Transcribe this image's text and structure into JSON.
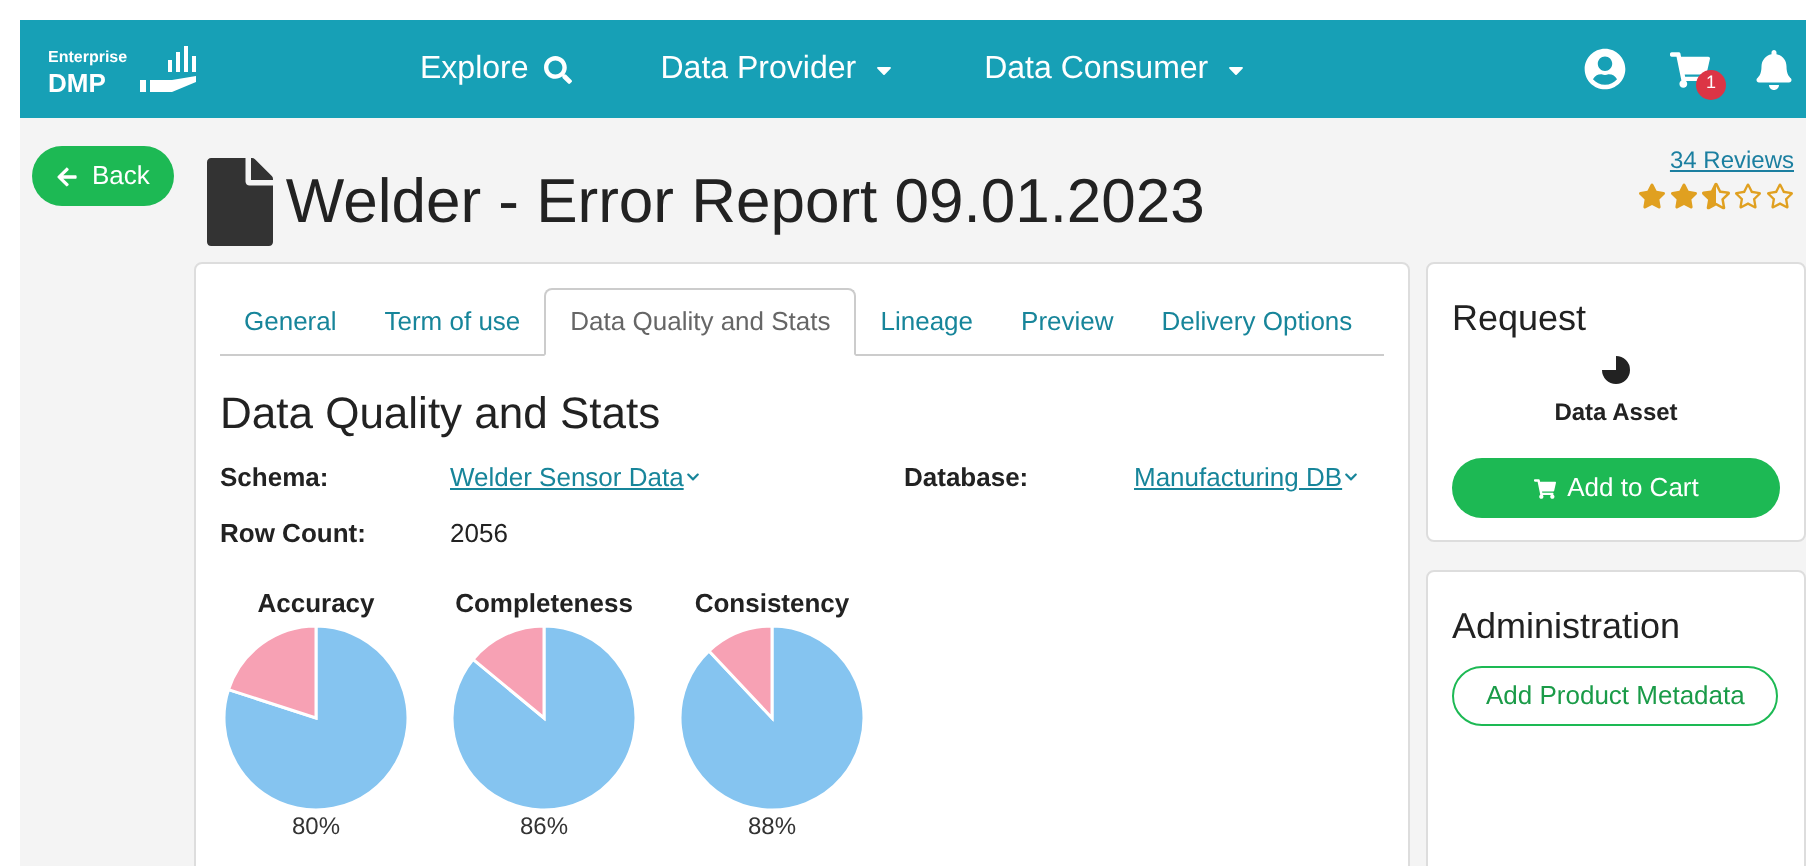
{
  "navbar": {
    "logo": {
      "line1": "Enterprise",
      "line2": "DMP"
    },
    "links": [
      {
        "label": "Explore",
        "kind": "search"
      },
      {
        "label": "Data Provider",
        "kind": "dropdown"
      },
      {
        "label": "Data Consumer",
        "kind": "dropdown"
      }
    ],
    "cart_count": "1"
  },
  "back_button": "Back",
  "title": "Welder - Error Report 09.01.2023",
  "reviews": {
    "link": "34 Reviews",
    "stars": 2.5
  },
  "tabs": [
    {
      "label": "General",
      "selected": false
    },
    {
      "label": "Term of use",
      "selected": false
    },
    {
      "label": "Data Quality and Stats",
      "selected": true
    },
    {
      "label": "Lineage",
      "selected": false
    },
    {
      "label": "Preview",
      "selected": false
    },
    {
      "label": "Delivery Options",
      "selected": false
    }
  ],
  "section": {
    "heading": "Data Quality and Stats",
    "fields": [
      {
        "label": "Schema:",
        "value": "Welder Sensor Data",
        "kind": "link"
      },
      {
        "label": "Database:",
        "value": "Manufacturing DB",
        "kind": "link"
      },
      {
        "label": "Row Count:",
        "value": "2056",
        "kind": "text"
      }
    ]
  },
  "charts": [
    {
      "reading": "80%",
      "chart_data": {
        "type": "pie",
        "title": "Accuracy",
        "values": [
          80,
          20
        ]
      }
    },
    {
      "reading": "86%",
      "chart_data": {
        "type": "pie",
        "title": "Completeness",
        "values": [
          86,
          14
        ]
      }
    },
    {
      "reading": "88%",
      "chart_data": {
        "type": "pie",
        "title": "Consistency",
        "values": [
          88,
          12
        ]
      }
    }
  ],
  "request": {
    "heading": "Request",
    "asset_label": "Data Asset",
    "button": "Add to Cart"
  },
  "administration": {
    "heading": "Administration",
    "button": "Add Product Metadata"
  }
}
